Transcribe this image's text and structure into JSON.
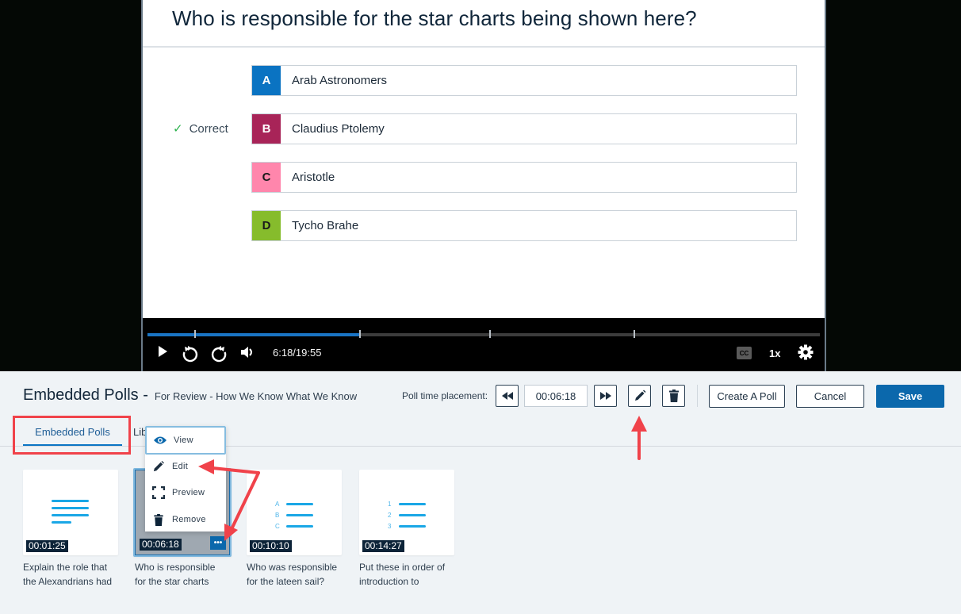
{
  "video": {
    "question": "Who is responsible for the star charts being shown here?",
    "correct_label": "Correct",
    "correct_index": 1,
    "answers": [
      {
        "letter": "A",
        "text": "Arab Astronomers",
        "color": "#0a73c2",
        "letter_color": "#ffffff"
      },
      {
        "letter": "B",
        "text": "Claudius Ptolemy",
        "color": "#a82458",
        "letter_color": "#ffffff"
      },
      {
        "letter": "C",
        "text": "Aristotle",
        "color": "#ff86ac",
        "letter_color": "#1a1a1a"
      },
      {
        "letter": "D",
        "text": "Tycho Brahe",
        "color": "#86bc2c",
        "letter_color": "#1a1a1a"
      }
    ],
    "controls": {
      "current_time": "6:18",
      "duration": "19:55",
      "time_readout": "6:18/19:55",
      "progress_fraction": 0.316,
      "poll_markers_fraction": [
        0.071,
        0.316,
        0.509,
        0.724
      ],
      "cc_label": "CC",
      "speed_label": "1x",
      "accent_color": "#1a74c4"
    }
  },
  "editor": {
    "title": "Embedded Polls -",
    "subtitle": "For Review - How We Know What We Know",
    "placement_label": "Poll time placement:",
    "placement_time": "00:06:18",
    "create_poll_label": "Create A Poll",
    "cancel_label": "Cancel",
    "save_label": "Save",
    "save_color": "#0b68ac",
    "tabs": [
      {
        "label": "Embedded Polls",
        "active": true
      },
      {
        "label": "Library",
        "active": false
      }
    ],
    "context_menu": [
      {
        "label": "View",
        "icon": "eye-icon"
      },
      {
        "label": "Edit",
        "icon": "pencil-icon"
      },
      {
        "label": "Preview",
        "icon": "fullscreen-icon"
      },
      {
        "label": "Remove",
        "icon": "trash-icon"
      }
    ],
    "polls": [
      {
        "time": "00:01:25",
        "type": "open-text",
        "caption_line1": "Explain the role that",
        "caption_line2": "the Alexandrians had",
        "selected": false
      },
      {
        "time": "00:06:18",
        "type": "multiple-choice",
        "caption_line1": "Who is responsible",
        "caption_line2": "for the star charts",
        "selected": true
      },
      {
        "time": "00:10:10",
        "type": "multiple-choice",
        "caption_line1": "Who was responsible",
        "caption_line2": "for the lateen sail?",
        "selected": false
      },
      {
        "time": "00:14:27",
        "type": "ordering",
        "caption_line1": "Put these in order of",
        "caption_line2": "introduction to",
        "selected": false
      }
    ],
    "more_label": "•••",
    "list_letters": [
      "A",
      "B",
      "C"
    ],
    "list_numbers": [
      "1",
      "2",
      "3"
    ]
  }
}
